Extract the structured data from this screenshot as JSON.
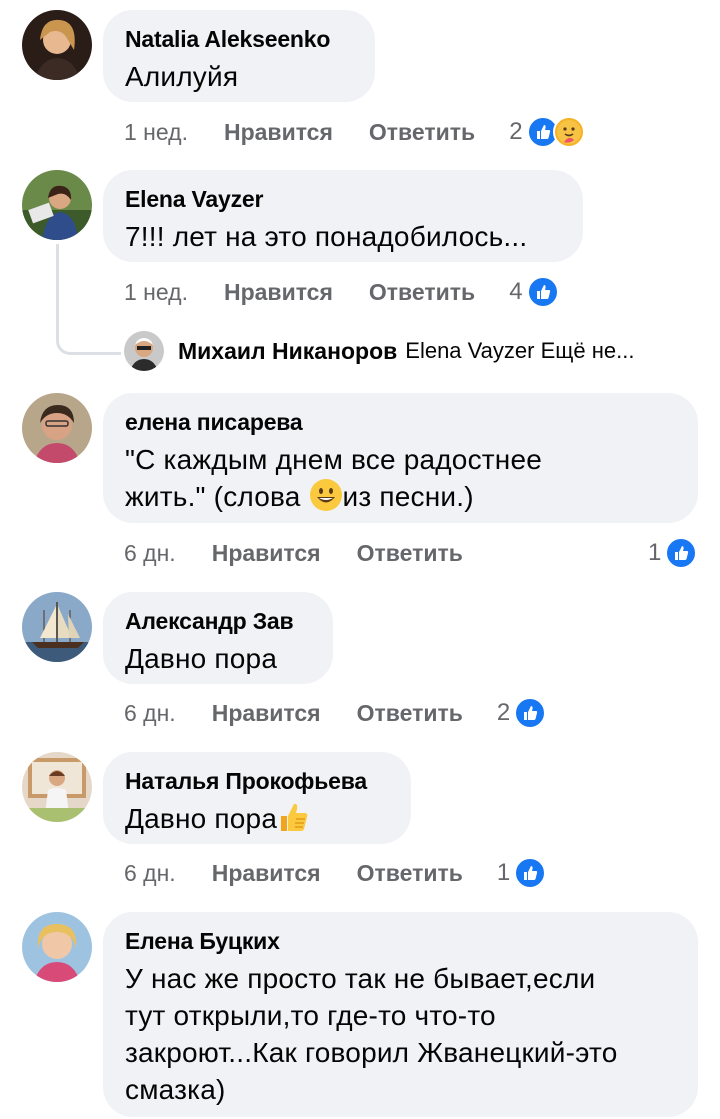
{
  "comments": [
    {
      "author": "Natalia Alekseenko",
      "text": "Алилуйя",
      "time": "1 нед.",
      "like_label": "Нравится",
      "reply_label": "Ответить",
      "reaction_count": "2",
      "reactions": [
        "like-icon",
        "care-icon"
      ]
    },
    {
      "author": "Elena Vayzer",
      "text": "7!!! лет на это понадобилось...",
      "time": "1 нед.",
      "like_label": "Нравится",
      "reply_label": "Ответить",
      "reaction_count": "4",
      "reactions": [
        "like-icon"
      ],
      "reply_preview": {
        "author": "Михаил Никаноров",
        "text": "Elena Vayzer Ещё не..."
      }
    },
    {
      "author": "елена писарева",
      "text_line1": "\"С каждым днем все радостнее",
      "text_line2_a": "жить.\"  (слова ",
      "text_line2_b": "из песни.)",
      "time": "6 дн.",
      "like_label": "Нравится",
      "reply_label": "Ответить",
      "reaction_count": "1",
      "reactions": [
        "like-icon"
      ]
    },
    {
      "author": "Александр Зав",
      "text": "Давно пора",
      "time": "6 дн.",
      "like_label": "Нравится",
      "reply_label": "Ответить",
      "reaction_count": "2",
      "reactions": [
        "like-icon"
      ]
    },
    {
      "author": "Наталья Прокофьева",
      "text": "Давно пора",
      "time": "6 дн.",
      "like_label": "Нравится",
      "reply_label": "Ответить",
      "reaction_count": "1",
      "reactions": [
        "like-icon"
      ]
    },
    {
      "author": "Елена Буцких",
      "text_lines": [
        "У нас же просто так не бывает,если",
        "тут открыли,то где-то что-то",
        "закроют...Как говорил Жванецкий-это",
        "смазка)"
      ]
    }
  ],
  "colors": {
    "bubble": "#f0f2f5",
    "meta_text": "#65676b",
    "like_blue": "#1877f2"
  }
}
